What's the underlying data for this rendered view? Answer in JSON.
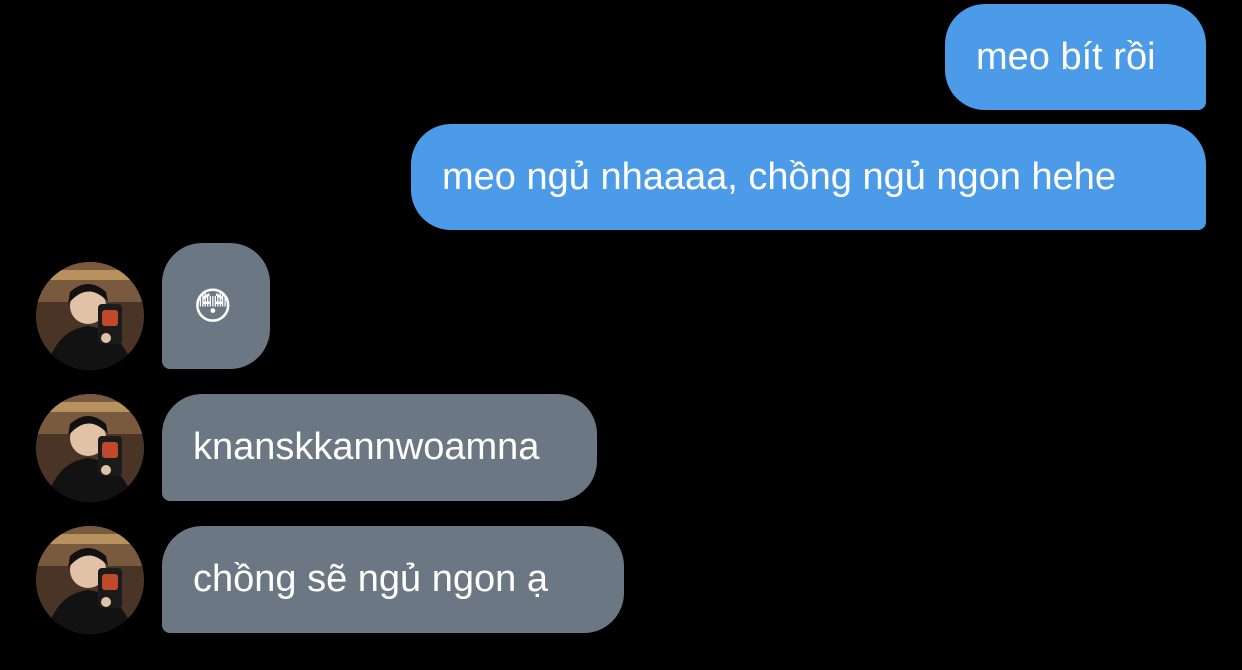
{
  "messages": {
    "outgoing": [
      {
        "text": "meo bít rồi"
      },
      {
        "text": "meo ngủ nhaaaa, chồng ngủ ngon hehe"
      }
    ],
    "incoming": [
      {
        "text": "😳"
      },
      {
        "text": "knanskkannwoamna"
      },
      {
        "text": "chồng sẽ ngủ ngon ạ"
      }
    ]
  },
  "colors": {
    "background": "#000000",
    "outgoing_bubble": "#4b9be8",
    "incoming_bubble": "#6b7783",
    "text": "#ffffff"
  },
  "icons": {
    "avatar": "contact-avatar-photo"
  }
}
